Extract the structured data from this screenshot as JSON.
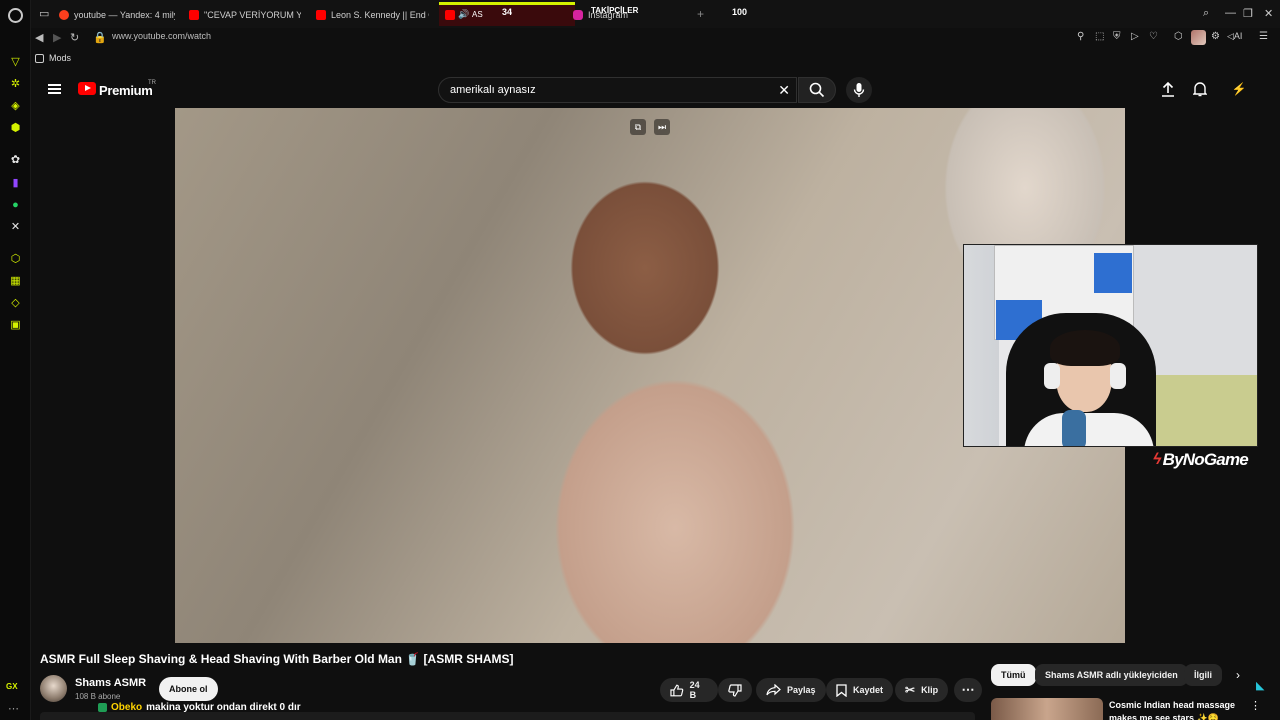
{
  "browser": {
    "tabs": [
      {
        "label": "youtube — Yandex: 4 milyon",
        "favicon": "yandex"
      },
      {
        "label": "\"CEVAP VERİYORUM YAR",
        "favicon": "youtube"
      },
      {
        "label": "Leon S. Kennedy || End Of",
        "favicon": "youtube"
      },
      {
        "label": "Instagram",
        "favicon": "instagram"
      }
    ],
    "active_tab_label": "AS",
    "overlay": {
      "left_count": "34",
      "title": "TAKİPÇİLER",
      "right_count": "100"
    },
    "address": {
      "url": "www.youtube.com/watch"
    },
    "bookmark_folder": "Mods",
    "sidebar_bottom_label": "GX",
    "extension_ai_label": "AI",
    "accent_color": "#d5f200"
  },
  "youtube": {
    "brand": "Premium",
    "country_code": "TR",
    "search": {
      "value": "amerikalı aynasız",
      "placeholder": "Ara"
    },
    "video": {
      "title": "ASMR Full Sleep Shaving & Head Shaving With Barber Old Man 🥤 [ASMR SHAMS]",
      "webcam_brand": "ByNoGame"
    },
    "channel": {
      "name": "Shams ASMR",
      "subscribers": "108 B abone",
      "subscribe_label": "Abone ol"
    },
    "actions": {
      "likes": "24 B",
      "share": "Paylaş",
      "save": "Kaydet",
      "clip": "Klip"
    },
    "chat": {
      "user": "Obeko",
      "message": "makina yoktur ondan direkt 0 dır"
    },
    "chips": [
      "Tümü",
      "Shams ASMR adlı yükleyiciden",
      "İlgili"
    ],
    "recommendation": {
      "title": "Cosmic Indian head massage makes me see stars ✨🤤"
    }
  }
}
